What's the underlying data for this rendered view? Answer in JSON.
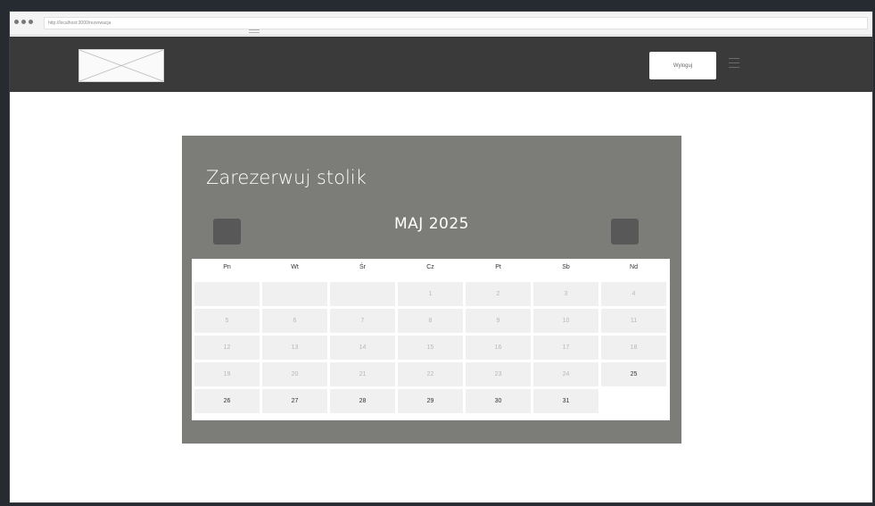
{
  "browser": {
    "url": "http://localhost:3000/rezerwacja"
  },
  "header": {
    "logout_label": "Wyloguj"
  },
  "reservation": {
    "title": "Zarezerwuj stolik",
    "month": "MAJ 2025",
    "weekdays": [
      "Pn",
      "Wt",
      "Śr",
      "Cz",
      "Pt",
      "Sb",
      "Nd"
    ],
    "days": [
      {
        "label": "",
        "state": "empty"
      },
      {
        "label": "",
        "state": "empty"
      },
      {
        "label": "",
        "state": "empty"
      },
      {
        "label": "1",
        "state": "disabled"
      },
      {
        "label": "2",
        "state": "disabled"
      },
      {
        "label": "3",
        "state": "disabled"
      },
      {
        "label": "4",
        "state": "disabled"
      },
      {
        "label": "5",
        "state": "disabled"
      },
      {
        "label": "6",
        "state": "disabled"
      },
      {
        "label": "7",
        "state": "disabled"
      },
      {
        "label": "8",
        "state": "disabled"
      },
      {
        "label": "9",
        "state": "disabled"
      },
      {
        "label": "10",
        "state": "disabled"
      },
      {
        "label": "11",
        "state": "disabled"
      },
      {
        "label": "12",
        "state": "disabled"
      },
      {
        "label": "13",
        "state": "disabled"
      },
      {
        "label": "14",
        "state": "disabled"
      },
      {
        "label": "15",
        "state": "disabled"
      },
      {
        "label": "16",
        "state": "disabled"
      },
      {
        "label": "17",
        "state": "disabled"
      },
      {
        "label": "18",
        "state": "disabled"
      },
      {
        "label": "19",
        "state": "disabled"
      },
      {
        "label": "20",
        "state": "disabled"
      },
      {
        "label": "21",
        "state": "disabled"
      },
      {
        "label": "22",
        "state": "disabled"
      },
      {
        "label": "23",
        "state": "disabled"
      },
      {
        "label": "24",
        "state": "disabled"
      },
      {
        "label": "25",
        "state": "active"
      },
      {
        "label": "26",
        "state": "active"
      },
      {
        "label": "27",
        "state": "active"
      },
      {
        "label": "28",
        "state": "active"
      },
      {
        "label": "29",
        "state": "active"
      },
      {
        "label": "30",
        "state": "active"
      },
      {
        "label": "31",
        "state": "active"
      }
    ]
  },
  "icons": {
    "logo": "image-placeholder-icon",
    "prev": "chevron-left-icon",
    "next": "chevron-right-icon",
    "menu": "hamburger-icon"
  },
  "colors": {
    "header": "#3a3a3a",
    "panel": "#7c7c78",
    "nav_button": "#585858",
    "day_cell": "#f0f0f0"
  }
}
